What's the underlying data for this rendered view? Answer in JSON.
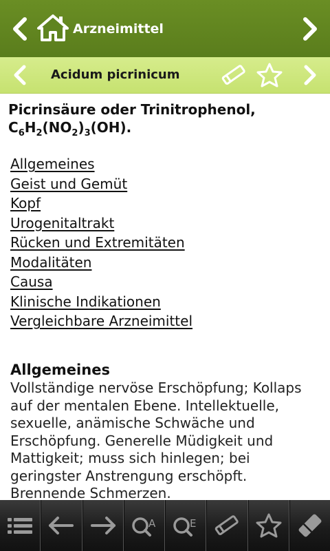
{
  "header": {
    "title": "Arzneimittel",
    "icons": [
      "chevron-left-icon",
      "home-icon",
      "chevron-right-icon"
    ]
  },
  "subheader": {
    "title": "Acidum picrinicum",
    "icons": [
      "chevron-left-icon",
      "pencil-icon",
      "star-icon",
      "chevron-right-icon"
    ]
  },
  "content": {
    "heading_line1": "Picrinsäure oder Trinitrophenol,",
    "formula": {
      "c": "C",
      "c_sub": "6",
      "h": "H",
      "h_sub": "2",
      "no2_open": "(NO",
      "no2_sub": "2",
      "no2_close": ")",
      "no2_mult": "3",
      "oh": "(OH)."
    },
    "toc": [
      "Allgemeines",
      "Geist und Gemüt",
      "Kopf",
      "Urogenitaltrakt",
      "Rücken und Extremitäten",
      "Modalitäten",
      "Causa",
      "Klinische Indikationen",
      "Vergleichbare Arzneimittel"
    ],
    "section": {
      "title": "Allgemeines",
      "text": "Vollständige nervöse Erschöpfung; Kollaps auf der mentalen Ebene. Intellektuelle, sexuelle, anämische Schwäche und Erschöpfung. Generelle Müdigkeit und Mattigkeit; muss sich hinlegen; bei geringster Anstrengung erschöpft. Brennende Schmerzen."
    }
  },
  "toolbar": {
    "buttons": [
      {
        "icon": "list-icon"
      },
      {
        "icon": "arrow-left-icon"
      },
      {
        "icon": "arrow-right-icon"
      },
      {
        "icon": "search-a-icon",
        "label": "A"
      },
      {
        "icon": "search-e-icon",
        "label": "E"
      },
      {
        "icon": "pencil-icon"
      },
      {
        "icon": "star-icon"
      },
      {
        "icon": "eraser-icon"
      }
    ]
  },
  "colors": {
    "header_bg": "#5f8420",
    "subheader_bg": "#cfe87e",
    "toolbar_bg": "#1c1c1c"
  }
}
